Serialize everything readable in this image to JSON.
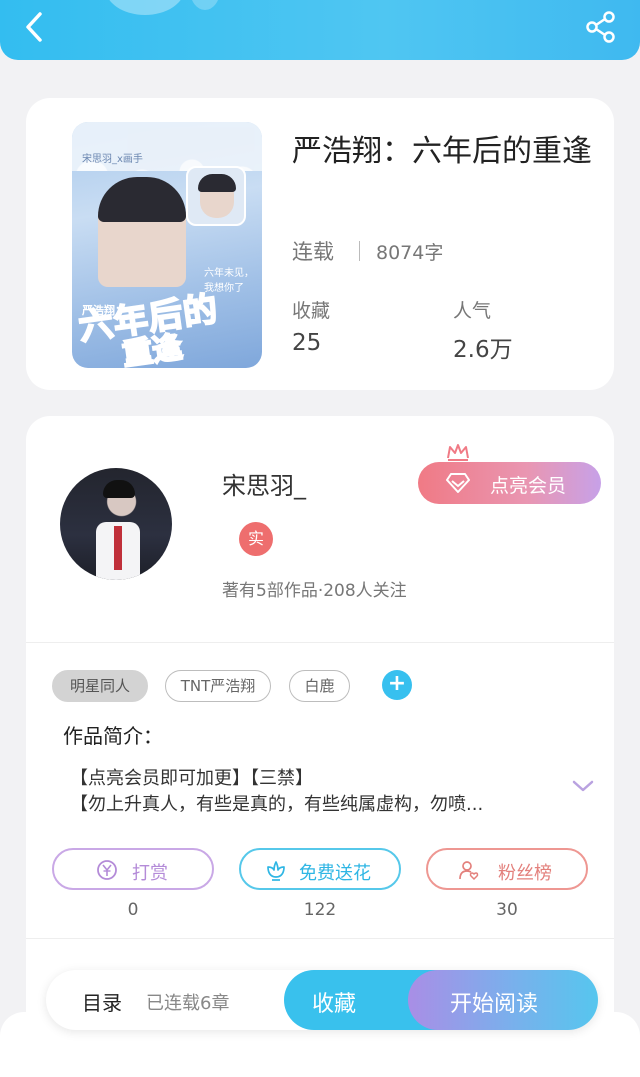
{
  "book": {
    "title": "严浩翔：六年后的重逢",
    "status": "连载",
    "word_count": "8074字",
    "stats": [
      {
        "label": "收藏",
        "value": "25"
      },
      {
        "label": "人气",
        "value": "2.6万"
      }
    ],
    "cover_text": {
      "top": "宋思羽_x画手",
      "bubble": "六年未见，我想你了",
      "name": "严浩翔：",
      "title_line1": "六年后的",
      "title_line2": "重逢"
    }
  },
  "author": {
    "name": "宋思羽_",
    "verify_badge": "实",
    "meta": "著有5部作品·208人关注",
    "vip_button": "点亮会员"
  },
  "tags": [
    "明星同人",
    "TNT严浩翔",
    "白鹿"
  ],
  "tag_add": "+",
  "intro": {
    "title": "作品简介：",
    "lines": [
      "【点亮会员即可加更】【三禁】",
      "【勿上升真人，有些是真的，有些纯属虚构，勿喷..."
    ]
  },
  "actions": [
    {
      "label": "打赏",
      "count": "0",
      "color": "#c49be0"
    },
    {
      "label": "免费送花",
      "count": "122",
      "color": "#49c4e8"
    },
    {
      "label": "粉丝榜",
      "count": "30",
      "color": "#ea8a86"
    }
  ],
  "bottom_bar": {
    "toc_label": "目录",
    "toc_count": "已连载6章",
    "favorite": "收藏",
    "read": "开始阅读"
  },
  "colors": {
    "accent": "#39c1ed",
    "topbar": "#33bdf0",
    "vip": "#f07a85"
  }
}
